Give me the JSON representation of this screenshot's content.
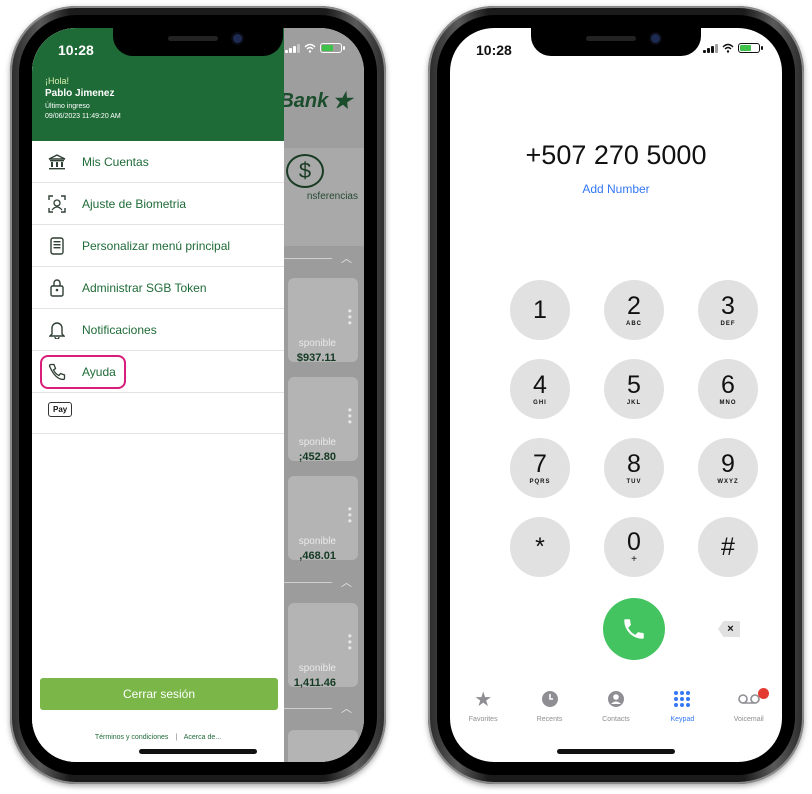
{
  "left_phone": {
    "status": {
      "time": "10:28"
    },
    "drawer": {
      "greeting": "¡Hola!",
      "user_name": "Pablo Jimenez",
      "last_login_label": "Último ingreso",
      "last_login_value": "09/06/2023 11:49:20 AM",
      "menu": [
        {
          "label": "Mis Cuentas",
          "icon": "bank-icon"
        },
        {
          "label": "Ajuste de Biometria",
          "icon": "face-scan-icon"
        },
        {
          "label": "Personalizar menú principal",
          "icon": "phone-menu-icon"
        },
        {
          "label": "Administrar SGB Token",
          "icon": "token-lock-icon"
        },
        {
          "label": "Notificaciones",
          "icon": "bell-icon"
        },
        {
          "label": "Ayuda",
          "icon": "phone-call-icon",
          "highlighted": true
        }
      ],
      "apple_pay_label": "Pay",
      "logout_label": "Cerrar sesión",
      "terms_label": "Términos y condiciones",
      "separator": "|",
      "about_label": "Acerca de..."
    },
    "background": {
      "brand": "Bank",
      "transfer_label": "nsferencias",
      "accounts": [
        {
          "label": "sponible",
          "amount": "$937.11"
        },
        {
          "label": "sponible",
          "amount": ";452.80"
        },
        {
          "label": "sponible",
          "amount": ",468.01"
        },
        {
          "label": "sponible",
          "amount": "1,411.46"
        }
      ]
    }
  },
  "right_phone": {
    "status": {
      "time": "10:28"
    },
    "number": "+507 270 5000",
    "add_number": "Add Number",
    "keys": [
      {
        "digit": "1",
        "letters": ""
      },
      {
        "digit": "2",
        "letters": "ABC"
      },
      {
        "digit": "3",
        "letters": "DEF"
      },
      {
        "digit": "4",
        "letters": "GHI"
      },
      {
        "digit": "5",
        "letters": "JKL"
      },
      {
        "digit": "6",
        "letters": "MNO"
      },
      {
        "digit": "7",
        "letters": "PQRS"
      },
      {
        "digit": "8",
        "letters": "TUV"
      },
      {
        "digit": "9",
        "letters": "WXYZ"
      },
      {
        "digit": "*",
        "letters": ""
      },
      {
        "digit": "0",
        "letters": "+"
      },
      {
        "digit": "#",
        "letters": ""
      }
    ],
    "delete_symbol": "×",
    "tabs": [
      {
        "label": "Favorites",
        "icon": "star-icon"
      },
      {
        "label": "Recents",
        "icon": "clock-icon"
      },
      {
        "label": "Contacts",
        "icon": "person-icon"
      },
      {
        "label": "Keypad",
        "icon": "keypad-icon",
        "active": true
      },
      {
        "label": "Voicemail",
        "icon": "voicemail-icon",
        "badge": true
      }
    ]
  },
  "colors": {
    "bank_green": "#1f6b37",
    "logout_green": "#7ab648",
    "highlight_pink": "#d81d7a",
    "call_green": "#44c461",
    "ios_blue": "#3478f6"
  }
}
